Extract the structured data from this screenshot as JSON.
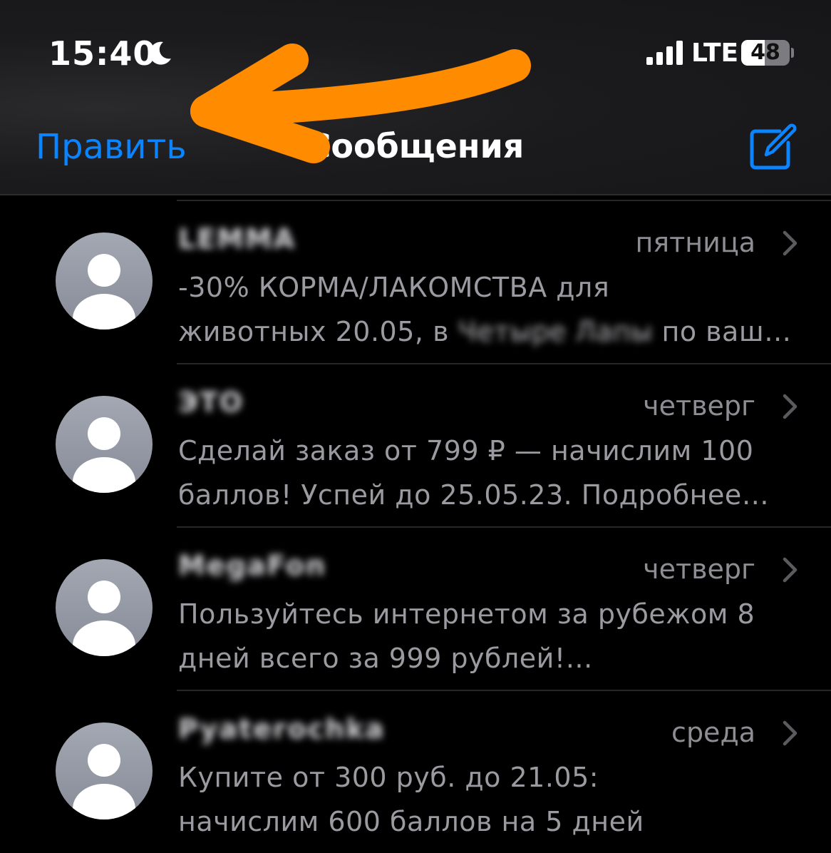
{
  "status_bar": {
    "time": "15:40",
    "network": "LTE",
    "battery_level": 48,
    "battery_label": "48",
    "icons": [
      "moon-icon",
      "signal-icon",
      "battery-icon"
    ]
  },
  "nav": {
    "edit_label": "Править",
    "title": "Сообщения",
    "compose_icon": "compose-icon"
  },
  "annotation": {
    "arrow_color": "#ff8c00"
  },
  "colors": {
    "accent": "#0a84ff",
    "background": "#000000",
    "secondary_text": "#8d8d93",
    "avatar": "#9ba0ab"
  },
  "messages": [
    {
      "sender": "LEMMA",
      "date": "пятница",
      "line1": "-30% КОРМА/ЛАКОМСТВА для",
      "line2_before": "животных 20.05, в ",
      "line2_redacted": "Четыре Лапы",
      "line2_after": " по ваш…"
    },
    {
      "sender": "ЭТО",
      "date": "четверг",
      "line1": "Сделай заказ от 799 ₽ — начислим 100",
      "line2_before": "баллов! Успей до 25.05.23. Подробнее…",
      "line2_redacted": "",
      "line2_after": ""
    },
    {
      "sender": "MegaFon",
      "date": "четверг",
      "line1": "Пользуйтесь интернетом за рубежом 8",
      "line2_before": "дней всего за 999 рублей!…",
      "line2_redacted": "",
      "line2_after": ""
    },
    {
      "sender": "Pyaterochka",
      "date": "среда",
      "line1": "Купите от 300 руб. до 21.05:",
      "line2_before": "начислим 600 баллов на 5 дней",
      "line2_redacted": "",
      "line2_after": ""
    }
  ]
}
